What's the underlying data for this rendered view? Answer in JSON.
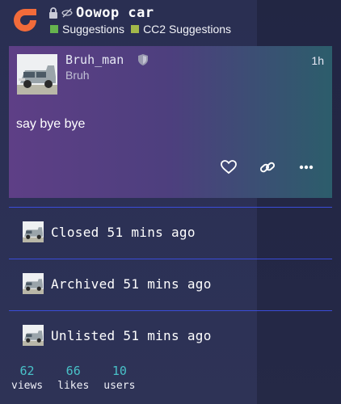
{
  "topic": {
    "title": "Oowop car",
    "categories": [
      {
        "name": "Suggestions",
        "color": "#66b34e"
      },
      {
        "name": "CC2 Suggestions",
        "color": "#a3b84a"
      }
    ]
  },
  "post": {
    "username": "Bruh_man",
    "display_name": "Bruh",
    "time": "1h",
    "content": "say bye bye"
  },
  "events": [
    {
      "text": "Closed 51 mins ago"
    },
    {
      "text": "Archived 51 mins ago"
    },
    {
      "text": "Unlisted 51 mins ago"
    }
  ],
  "stats": [
    {
      "value": "62",
      "label": "views"
    },
    {
      "value": "66",
      "label": "likes"
    },
    {
      "value": "10",
      "label": "users"
    }
  ],
  "colors": {
    "logo": "#f26b3a",
    "accent": "#49c1c8",
    "separator": "#3a4cd8"
  }
}
